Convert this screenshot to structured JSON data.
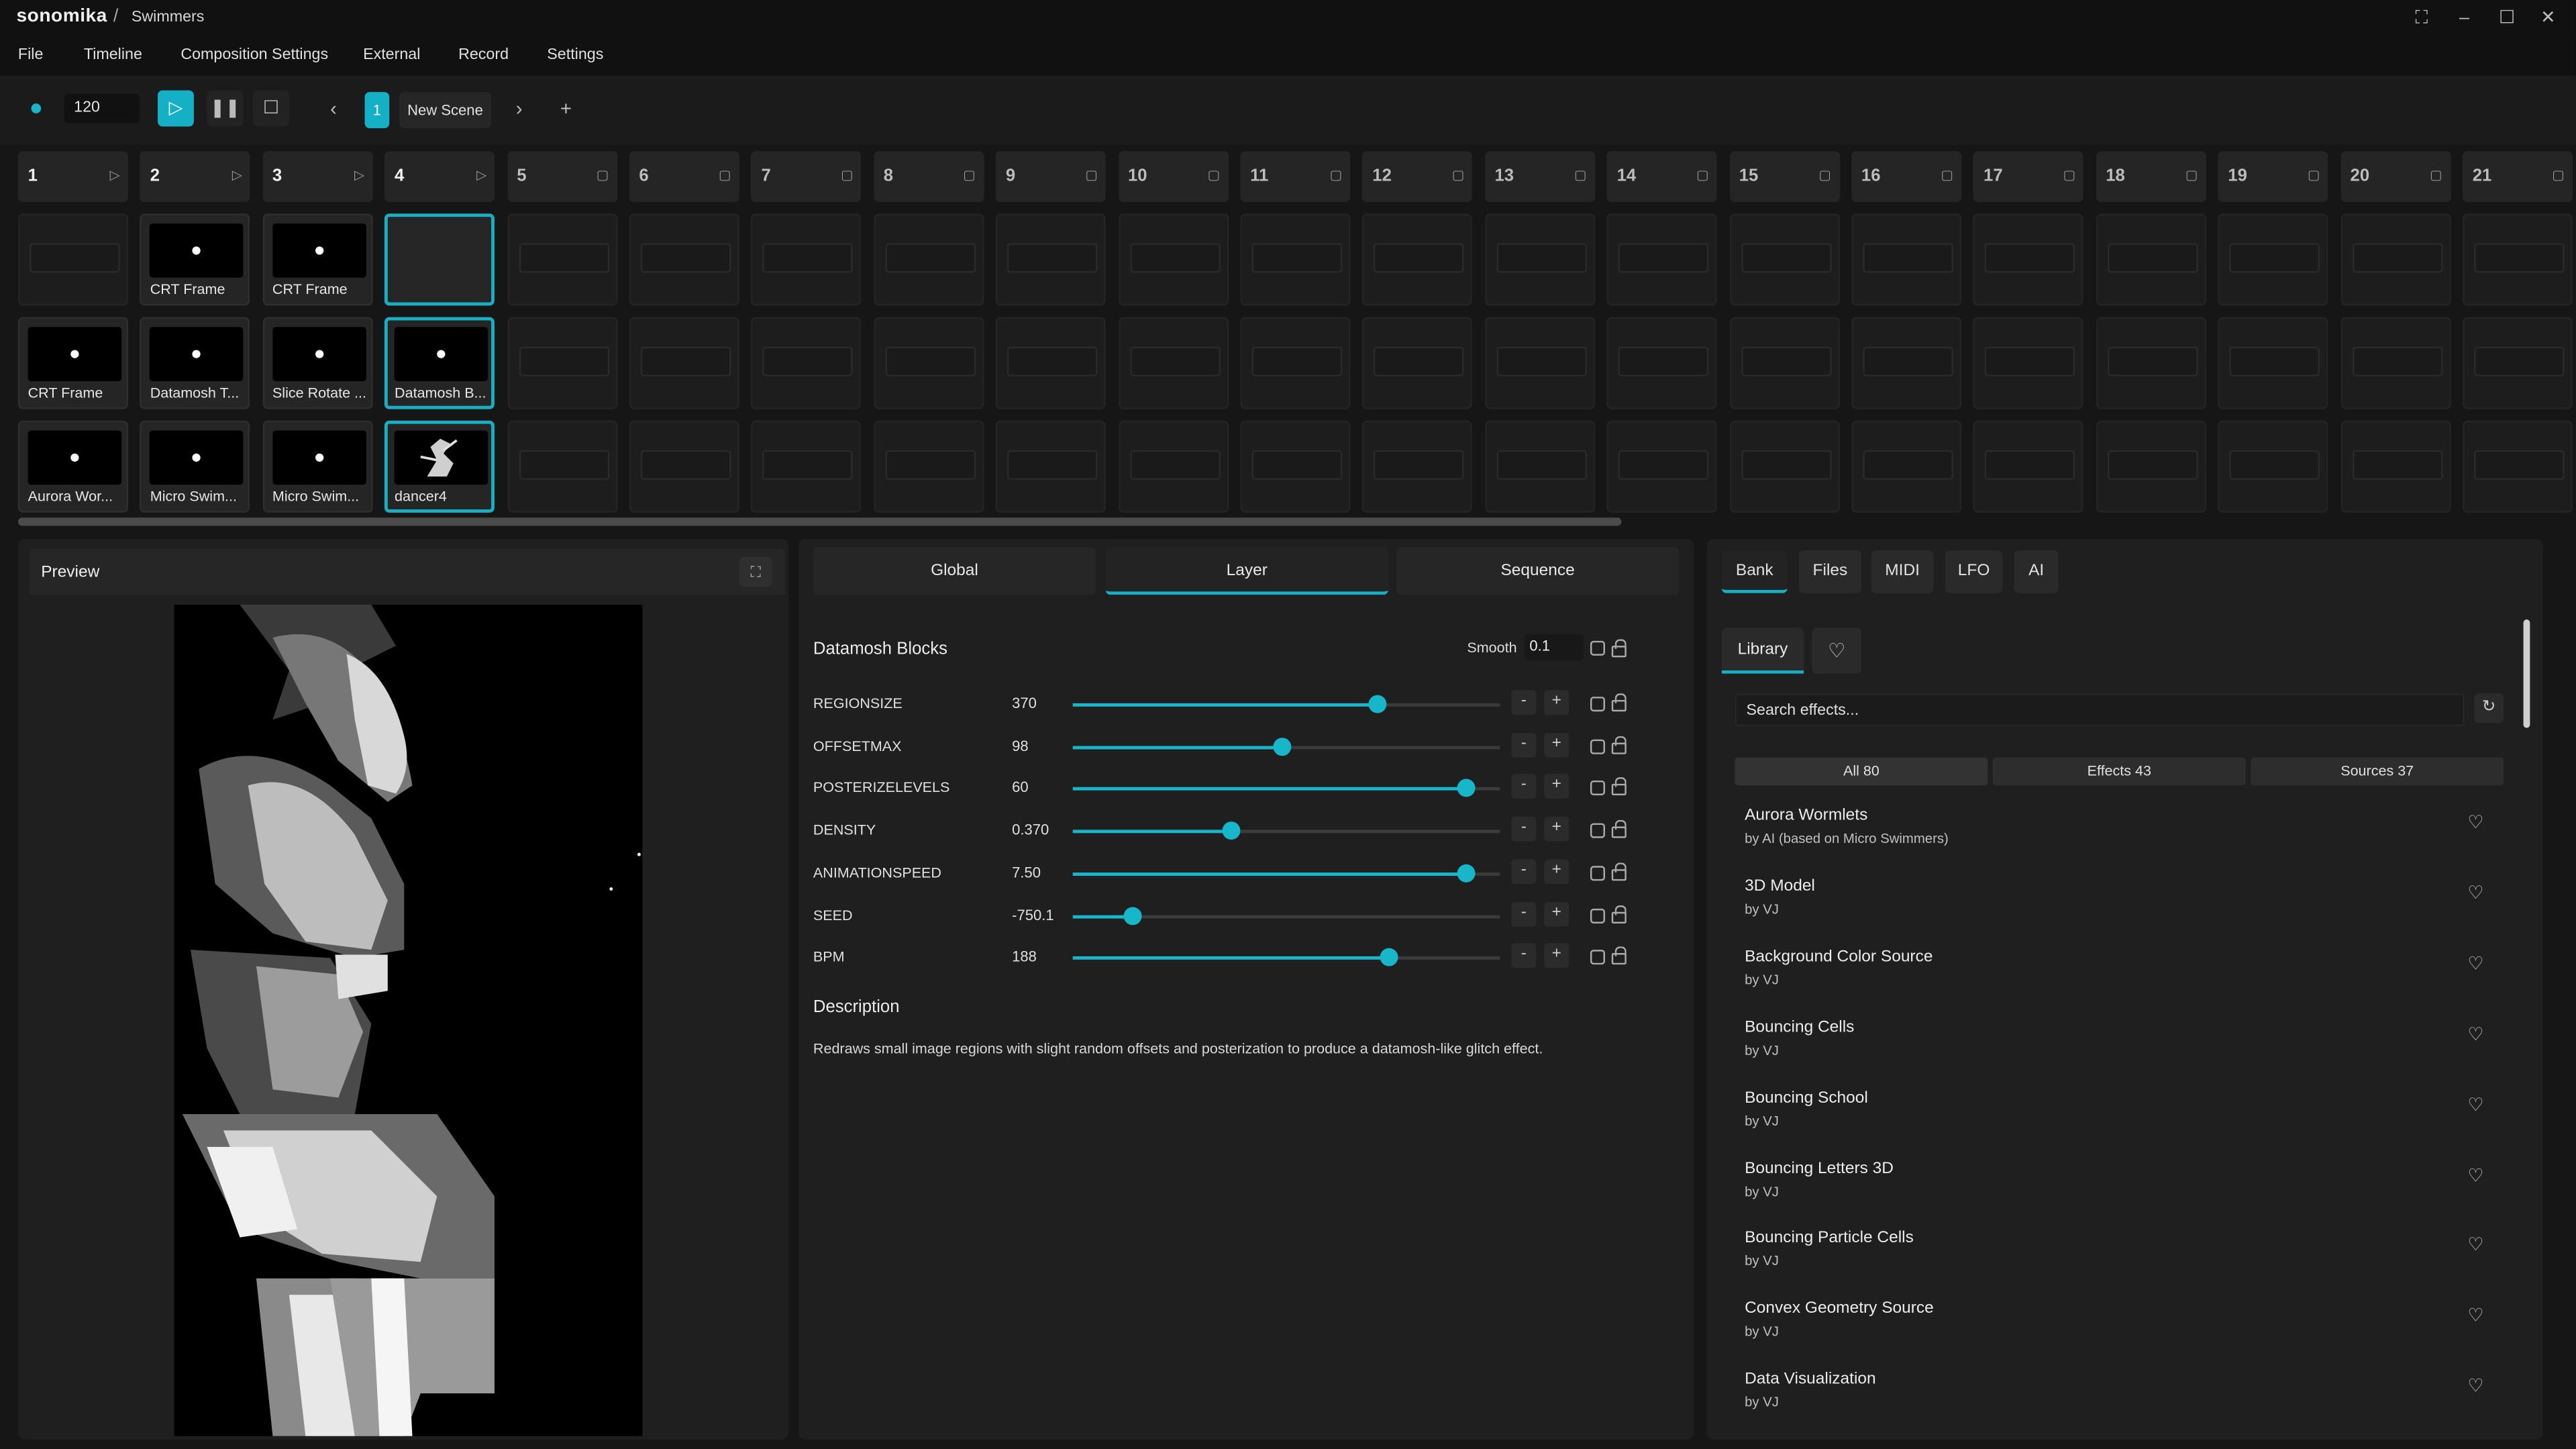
{
  "app": {
    "brand": "sonomika",
    "separator": "/",
    "project": "Swimmers"
  },
  "window_controls": [
    "fullscreen-icon",
    "minimize-icon",
    "maximize-icon",
    "close-icon"
  ],
  "menu": [
    "File",
    "Timeline",
    "Composition Settings",
    "External",
    "Record",
    "Settings"
  ],
  "transport": {
    "bpm": "120",
    "scene_number": "1",
    "scene_name": "New Scene",
    "prev": "‹",
    "next": "›",
    "add": "+"
  },
  "columns": [
    "1",
    "2",
    "3",
    "4",
    "5",
    "6",
    "7",
    "8",
    "9",
    "10",
    "11",
    "12",
    "13",
    "14",
    "15",
    "16",
    "17",
    "18",
    "19",
    "20",
    "21"
  ],
  "clips": {
    "row1": [
      "",
      "CRT Frame",
      "CRT Frame",
      ""
    ],
    "row2": [
      "CRT Frame",
      "Datamosh T...",
      "Slice Rotate ...",
      "Datamosh B..."
    ],
    "row3": [
      "Aurora Wor...",
      "Micro Swim...",
      "Micro Swim...",
      "dancer4"
    ]
  },
  "preview": {
    "title": "Preview"
  },
  "center": {
    "tabs": [
      "Global",
      "Layer",
      "Sequence"
    ],
    "active_tab": "Layer",
    "effect_title": "Datamosh Blocks",
    "smooth_label": "Smooth",
    "smooth_value": "0.1",
    "params": [
      {
        "name": "REGIONSIZE",
        "value": "370",
        "level": 0.71
      },
      {
        "name": "OFFSETMAX",
        "value": "98",
        "level": 0.49
      },
      {
        "name": "POSTERIZELEVELS",
        "value": "60",
        "level": 0.92
      },
      {
        "name": "DENSITY",
        "value": "0.370",
        "level": 0.37
      },
      {
        "name": "ANIMATIONSPEED",
        "value": "7.50",
        "level": 0.92
      },
      {
        "name": "SEED",
        "value": "-750.1",
        "level": 0.14
      },
      {
        "name": "BPM",
        "value": "188",
        "level": 0.74
      }
    ],
    "minus": "-",
    "plus": "+",
    "description_title": "Description",
    "description": "Redraws small image regions with slight random offsets and posterization to produce a datamosh-like glitch effect."
  },
  "right": {
    "tabs": [
      "Bank",
      "Files",
      "MIDI",
      "LFO",
      "AI"
    ],
    "active_tab": "Bank",
    "library_tab": "Library",
    "search_placeholder": "Search effects...",
    "filters": [
      "All 80",
      "Effects 43",
      "Sources 37"
    ],
    "effects": [
      {
        "name": "Aurora Wormlets",
        "by": "by AI (based on Micro Swimmers)"
      },
      {
        "name": "3D Model",
        "by": "by VJ"
      },
      {
        "name": "Background Color Source",
        "by": "by VJ"
      },
      {
        "name": "Bouncing Cells",
        "by": "by VJ"
      },
      {
        "name": "Bouncing School",
        "by": "by VJ"
      },
      {
        "name": "Bouncing Letters 3D",
        "by": "by VJ"
      },
      {
        "name": "Bouncing Particle Cells",
        "by": "by VJ"
      },
      {
        "name": "Convex Geometry Source",
        "by": "by VJ"
      },
      {
        "name": "Data Visualization",
        "by": "by VJ"
      }
    ]
  },
  "colors": {
    "accent": "#17b6c9",
    "background": "#161616",
    "panel": "#1f1f1f"
  }
}
